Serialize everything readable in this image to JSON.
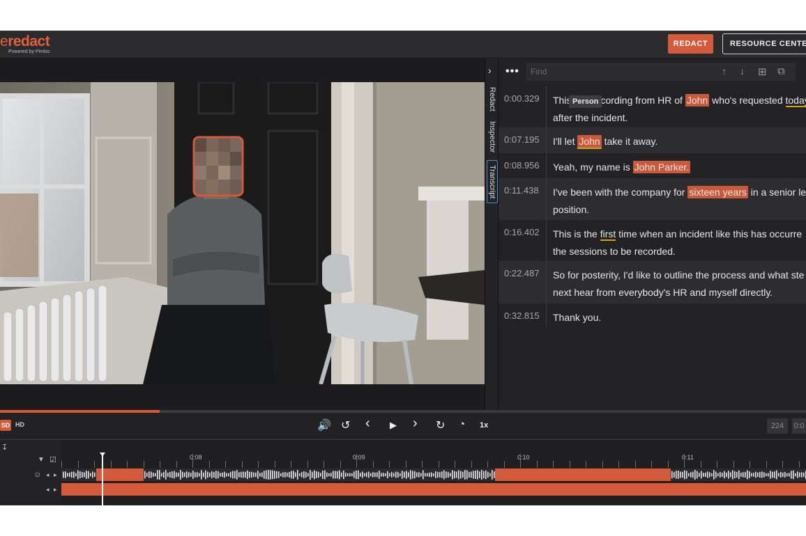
{
  "header": {
    "logo_prefix": "e",
    "logo_text": "redact",
    "logo_sub": "Powered by Pimloc",
    "redact_label": "REDACT",
    "resource_label": "RESOURCE CENTER"
  },
  "side_tabs": [
    "Redact",
    "Inspector",
    "Transcript"
  ],
  "active_tab": "Transcript",
  "find": {
    "placeholder": "Find"
  },
  "transcript": [
    {
      "time": "0:00.329",
      "line1": [
        {
          "t": "This is a recording from HR of "
        },
        {
          "t": "John",
          "hl": true
        },
        {
          "t": " who's requested "
        },
        {
          "t": "today",
          "ul": true
        }
      ],
      "line2": [
        {
          "t": "after the incident."
        }
      ]
    },
    {
      "time": "0:07.195",
      "line1": [
        {
          "t": "I'll let "
        },
        {
          "t": "John",
          "hl": true,
          "ul": true
        },
        {
          "t": " take it away."
        }
      ]
    },
    {
      "time": "0:08.956",
      "line1": [
        {
          "t": "Yeah, my name is "
        },
        {
          "t": "John Parker.",
          "hl": true
        }
      ]
    },
    {
      "time": "0:11.438",
      "line1": [
        {
          "t": "I've been with the company for "
        },
        {
          "t": "sixteen years",
          "hl": true
        },
        {
          "t": " in a senior lea"
        }
      ],
      "line2": [
        {
          "t": "position."
        }
      ]
    },
    {
      "time": "0:16.402",
      "line1": [
        {
          "t": "This is the "
        },
        {
          "t": "first",
          "ul": true
        },
        {
          "t": " time when an incident like this has occurre"
        }
      ],
      "line2": [
        {
          "t": "the sessions to be recorded."
        }
      ]
    },
    {
      "time": "0:22.487",
      "line1": [
        {
          "t": "So for posterity, I'd like to outline the process and what ste"
        }
      ],
      "line2": [
        {
          "t": "next hear from everybody's HR and myself directly."
        }
      ]
    },
    {
      "time": "0:32.815",
      "line1": [
        {
          "t": "Thank you."
        }
      ]
    }
  ],
  "tooltip": "Person",
  "controls": {
    "sd": "SD",
    "hd": "HD",
    "speed": "1x",
    "counter_a": "224",
    "counter_b": "0:0",
    "progress": 0.198
  },
  "timeline": {
    "labels": [
      "0:08",
      "0:09",
      "0:10",
      "0:11"
    ]
  },
  "colors": {
    "accent": "#d35a3b",
    "highlight": "#c75a3d",
    "underline": "#d4a31e"
  }
}
